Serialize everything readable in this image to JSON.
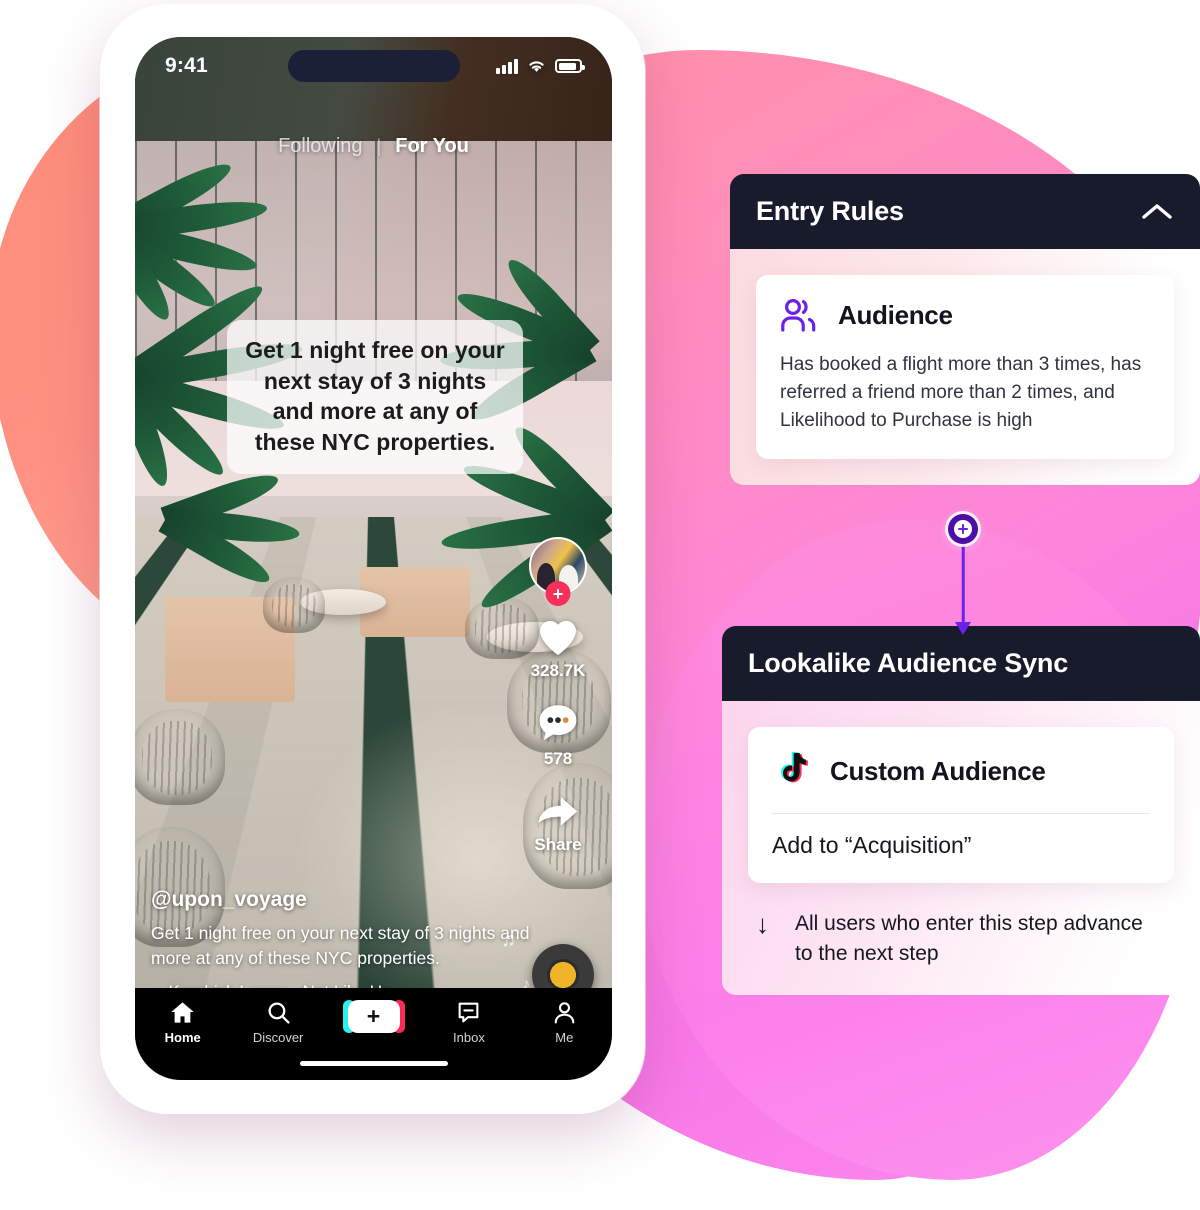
{
  "phone": {
    "status_bar": {
      "time": "9:41",
      "signal_icon": "cellular-bars-icon",
      "wifi_icon": "wifi-icon",
      "battery_icon": "battery-icon"
    },
    "feed_tabs": [
      {
        "label": "Following",
        "active": false
      },
      {
        "label": "For You",
        "active": true
      }
    ],
    "sticker_text": "Get 1 night free on your next stay of 3 nights and more at any of these NYC properties.",
    "rail": {
      "follow_glyph": "+",
      "like_icon": "heart-icon",
      "like_count": "328.7K",
      "comment_icon": "comment-icon",
      "comment_count": "578",
      "share_icon": "share-arrow-icon",
      "share_label": "Share"
    },
    "caption": {
      "username": "@upon_voyage",
      "text": "Get 1 night free on your next stay of 3 nights and more at any of these NYC properties.",
      "music_icon": "music-note-icon",
      "music": "Kendrick Lamar - Not Like Us"
    },
    "nav": [
      {
        "label": "Home",
        "icon": "home-icon",
        "active": true
      },
      {
        "label": "Discover",
        "icon": "search-icon",
        "active": false
      },
      {
        "label": "",
        "icon": "plus-create-icon",
        "active": false,
        "glyph": "+"
      },
      {
        "label": "Inbox",
        "icon": "inbox-icon",
        "active": false
      },
      {
        "label": "Me",
        "icon": "person-icon",
        "active": false
      }
    ]
  },
  "flow": {
    "entry_card": {
      "title": "Entry Rules",
      "collapse_icon": "chevron-up-icon",
      "audience": {
        "icon": "audience-people-icon",
        "title": "Audience",
        "description": "Has booked a flight more than 3 times, has referred a friend more than 2 times, and Likelihood to Purchase is high"
      }
    },
    "connector": {
      "node_icon": "plus-node-icon",
      "arrow_icon": "arrow-down-icon"
    },
    "sync_card": {
      "title": "Lookalike Audience Sync",
      "destination": {
        "icon": "tiktok-icon",
        "title": "Custom Audience",
        "action": "Add to “Acquisition”"
      },
      "advance_icon": "arrow-down-icon",
      "advance_text": "All users who enter this step advance to the next step"
    }
  },
  "colors": {
    "dark_header": "#171B2B",
    "purple_accent": "#6B21E8",
    "node_purple": "#4B0FA8",
    "tiktok_cyan": "#25F4EE",
    "tiktok_red": "#FE2C55",
    "follow_red": "#F6305A",
    "blob_coral": "#FF8D7A",
    "blob_pink": "#FB8BEE"
  }
}
